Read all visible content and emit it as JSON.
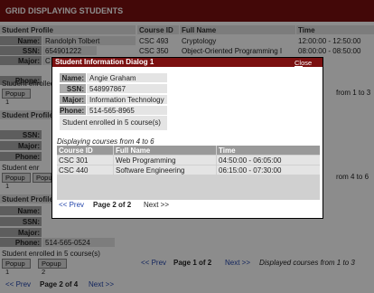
{
  "page": {
    "title": "GRID DISPLAYING STUDENTS"
  },
  "student_profile_header": "Student Profile",
  "course_headers": {
    "course_id": "Course ID",
    "full_name": "Full Name",
    "time": "Time"
  },
  "labels": {
    "name": "Name:",
    "ssn": "SSN:",
    "major": "Major:",
    "phone": "Phone:"
  },
  "popup_buttons": [
    "Popup 1",
    "Popup 2"
  ],
  "row1": {
    "name": "Randolph Tolbert",
    "ssn": "654901222",
    "major": "C",
    "phone": "5",
    "enrolled": "Student enrolled",
    "courses": [
      {
        "id": "CSC 493",
        "name": "Cryptology",
        "time": "12:00:00 - 12:50:00"
      },
      {
        "id": "CSC 350",
        "name": "Object-Oriented Programming I",
        "time": "08:00:00 - 08:50:00"
      }
    ],
    "course_pager": "from 1 to 3"
  },
  "row2": {
    "ssn_partial": "548",
    "major_partial": "Info",
    "phone_partial": "514",
    "enrolled": "Student enr",
    "course_pager": "rom 4 to 6",
    "popups": [
      "Popup 1",
      "Popu"
    ]
  },
  "row3": {
    "name_partial": "Mi",
    "ssn_partial": "47",
    "major": "C",
    "phone": "514-565-0524",
    "enrolled": "Student enrolled in 5 course(s)",
    "course_pager_prev": "<< Prev",
    "course_pager_page": "Page 1 of 2",
    "course_pager_next": "Next >>",
    "course_pager_text": "Displayed courses from 1 to 3"
  },
  "main_pager": {
    "prev": "<< Prev",
    "page": "Page 2 of 4",
    "next": "Next >>"
  },
  "dialog": {
    "title": "Student Information Dialog 1",
    "close_label": "Close",
    "close_icon": "X",
    "name": "Angie Graham",
    "ssn": "548997867",
    "major": "Information Technology",
    "phone": "514-565-8965",
    "enrolled": "Student enrolled in 5 course(s)",
    "displaying": "Displaying courses from 4 to 6",
    "columns": [
      "Course ID",
      "Full Name",
      "Time"
    ],
    "courses": [
      {
        "id": "CSC 301",
        "name": "Web Programming",
        "time": "04:50:00 - 06:05:00"
      },
      {
        "id": "CSC 440",
        "name": "Software Engineering",
        "time": "06:15:00 - 07:30:00"
      }
    ],
    "pager": {
      "prev": "<< Prev",
      "page": "Page 2 of 2",
      "next": "Next >>"
    }
  }
}
